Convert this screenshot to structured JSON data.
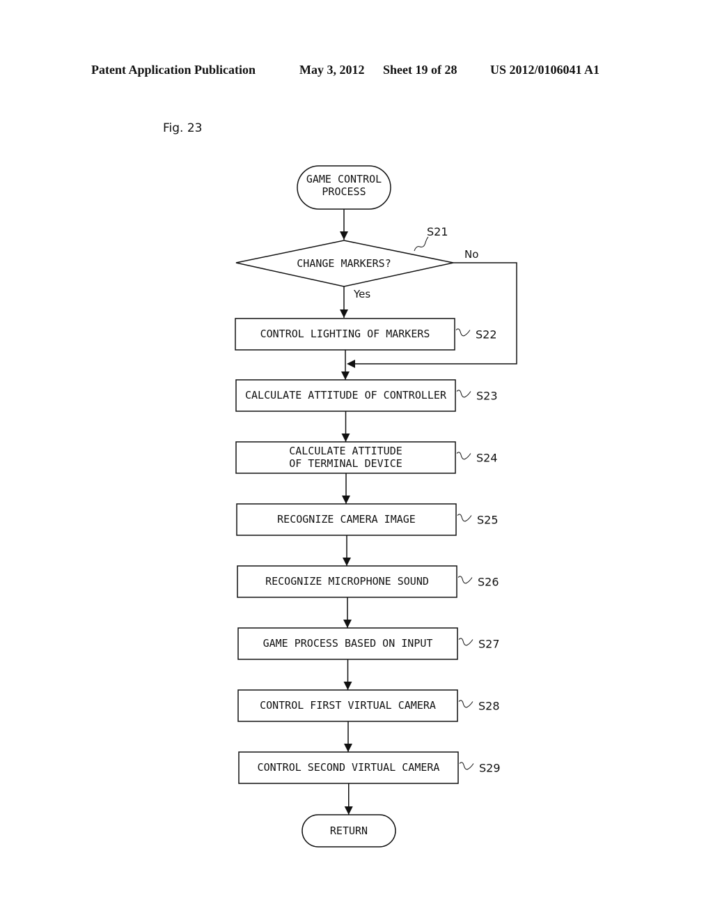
{
  "header": {
    "publication": "Patent Application Publication",
    "date": "May 3, 2012",
    "sheet": "Sheet 19 of 28",
    "number": "US 2012/0106041 A1"
  },
  "figure": {
    "label": "Fig. 23",
    "start": {
      "line1": "GAME CONTROL",
      "line2": "PROCESS"
    },
    "decision": {
      "text": "CHANGE MARKERS?",
      "step": "S21",
      "yes": "Yes",
      "no": "No"
    },
    "steps": [
      {
        "line1": "CONTROL LIGHTING OF MARKERS",
        "line2": "",
        "step": "S22"
      },
      {
        "line1": "CALCULATE ATTITUDE OF CONTROLLER",
        "line2": "",
        "step": "S23"
      },
      {
        "line1": "CALCULATE ATTITUDE",
        "line2": "OF TERMINAL DEVICE",
        "step": "S24"
      },
      {
        "line1": "RECOGNIZE CAMERA IMAGE",
        "line2": "",
        "step": "S25"
      },
      {
        "line1": "RECOGNIZE MICROPHONE SOUND",
        "line2": "",
        "step": "S26"
      },
      {
        "line1": "GAME PROCESS BASED ON INPUT",
        "line2": "",
        "step": "S27"
      },
      {
        "line1": "CONTROL FIRST VIRTUAL CAMERA",
        "line2": "",
        "step": "S28"
      },
      {
        "line1": "CONTROL SECOND VIRTUAL CAMERA",
        "line2": "",
        "step": "S29"
      }
    ],
    "end": {
      "text": "RETURN"
    }
  }
}
